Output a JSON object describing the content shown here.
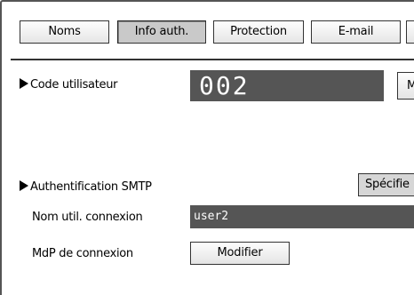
{
  "tabs": [
    {
      "label": "Noms",
      "active": false
    },
    {
      "label": "Info auth.",
      "active": true
    },
    {
      "label": "Protection",
      "active": false
    },
    {
      "label": "E-mail",
      "active": false
    }
  ],
  "user_code": {
    "label": "Code utilisateur",
    "value": "002",
    "button_label_partial": "M"
  },
  "smtp_auth": {
    "label": "Authentification SMTP",
    "button_label_partial": "Spécifie"
  },
  "login_user": {
    "label": "Nom util. connexion",
    "value": "user2"
  },
  "login_password": {
    "label": "MdP de connexion",
    "button_label": "Modifier"
  }
}
